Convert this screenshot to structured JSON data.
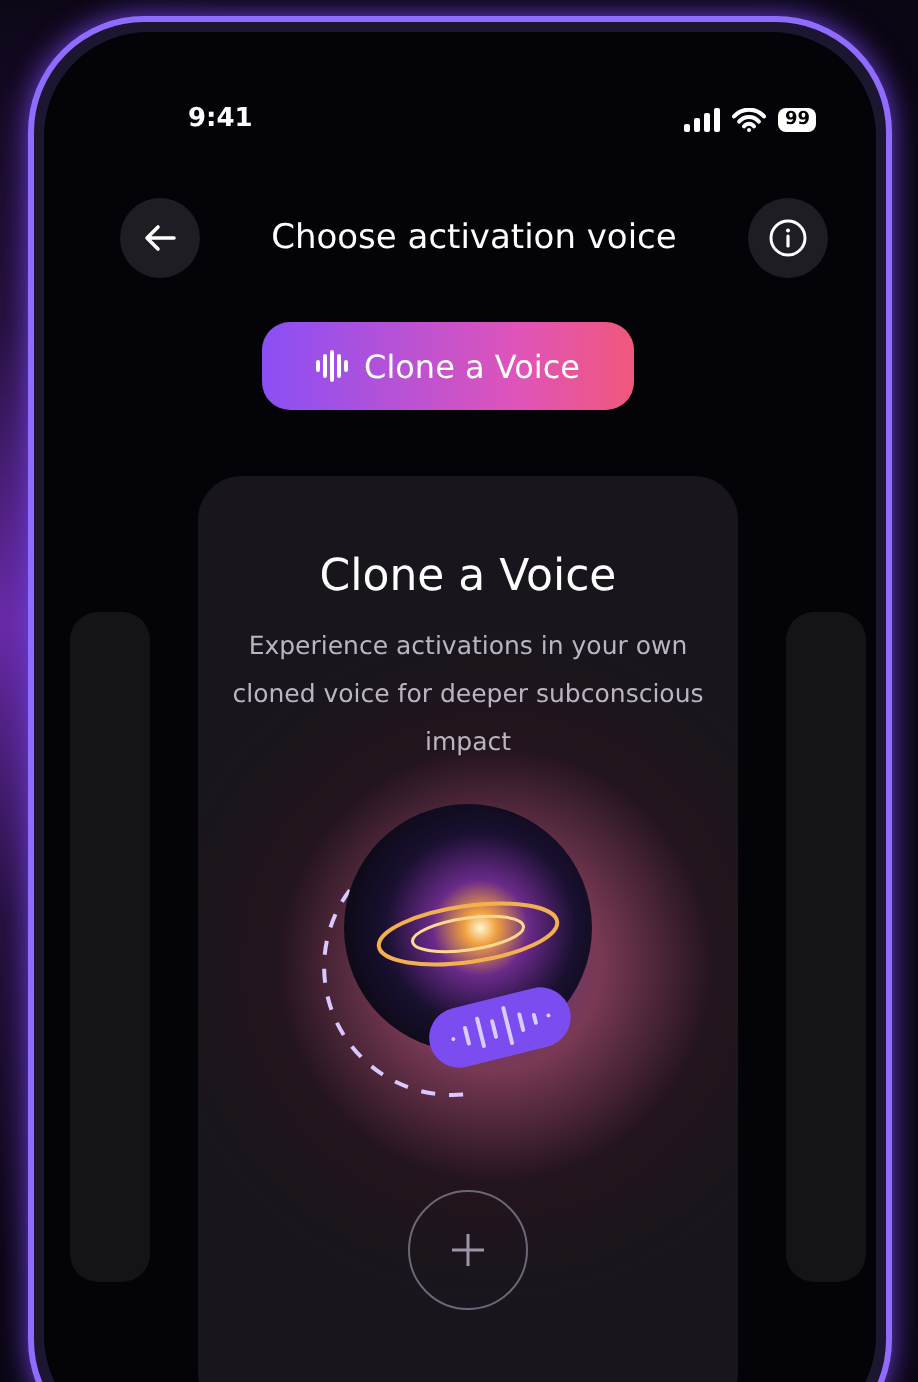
{
  "status_bar": {
    "time": "9:41",
    "battery": "99"
  },
  "header": {
    "title": "Choose activation voice"
  },
  "clone_button": {
    "label": "Clone a Voice"
  },
  "card": {
    "title": "Clone a Voice",
    "description": "Experience activations in your own cloned voice for deeper subconscious impact"
  }
}
